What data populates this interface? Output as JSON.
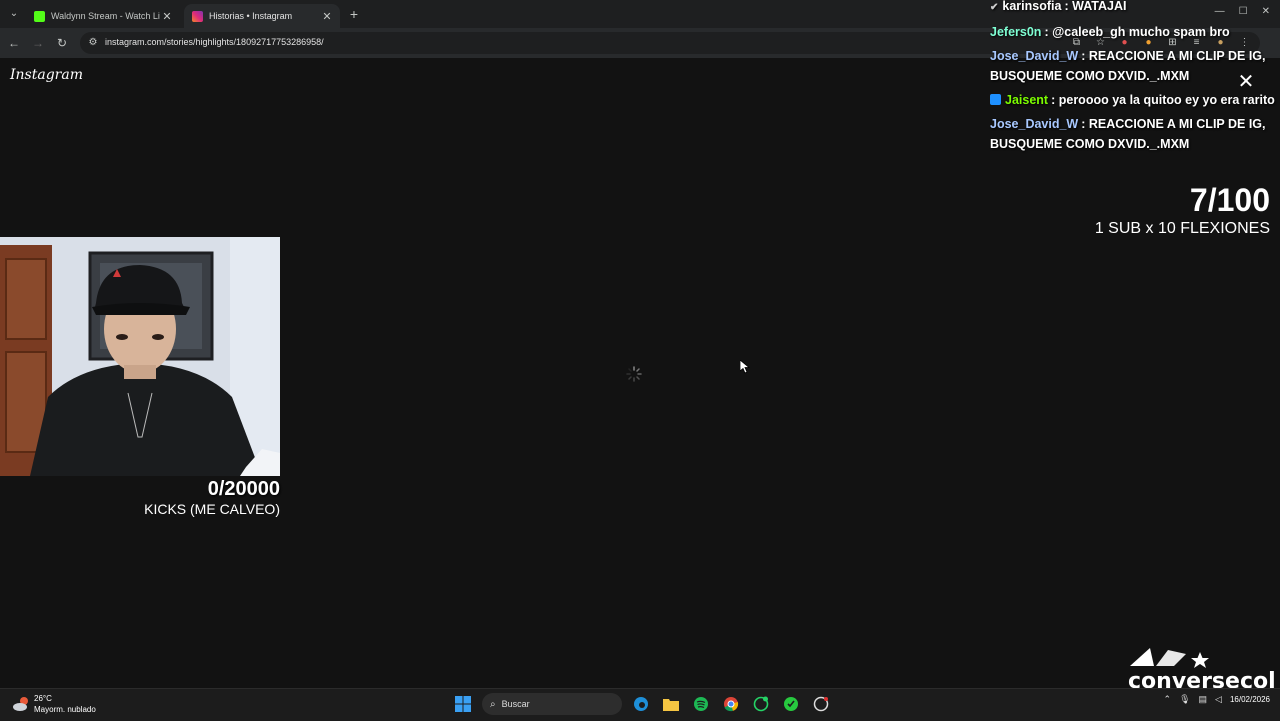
{
  "browser": {
    "tabs": [
      {
        "title": "Waldynn Stream - Watch Live o",
        "favicon_color": "#53fc18",
        "active": false
      },
      {
        "title": "Historias • Instagram",
        "favicon_color": "#e1306c",
        "active": true
      }
    ],
    "url": "instagram.com/stories/highlights/18092717753286958/"
  },
  "page": {
    "logo": "Instagram"
  },
  "overlay": {
    "kicks_goal": {
      "count": "0/20000",
      "label": "KICKS (ME CALVEO)"
    },
    "subs_goal": {
      "count": "7/100",
      "label": "1 SUB x 10 FLEXIONES"
    },
    "chat": [
      {
        "user": "karinsofia",
        "message": ": WATAJAI",
        "color": "#ffffff",
        "badge": "check"
      },
      {
        "user": "Jefers0n",
        "message": ": @caleeb_gh mucho spam bro",
        "color": "#7fffd4"
      },
      {
        "user": "Jose_David_W",
        "message": ": REACCIONE A MI CLIP DE IG, BUSQUEME COMO DXVID._.MXM",
        "color": "#a8c8ff"
      },
      {
        "user": "Jaisent",
        "message": ": peroooo ya la quitoo ey yo era rarito",
        "color": "#7cfc00",
        "badge": "blue"
      },
      {
        "user": "Jose_David_W",
        "message": ": REACCIONE A MI CLIP DE IG, BUSQUEME COMO DXVID._.MXM",
        "color": "#a8c8ff"
      }
    ],
    "brand": "conversecol"
  },
  "taskbar": {
    "weather": {
      "temp": "26°C",
      "condition": "Mayorm. nublado"
    },
    "search_placeholder": "Buscar",
    "date": "16/02/2026"
  }
}
